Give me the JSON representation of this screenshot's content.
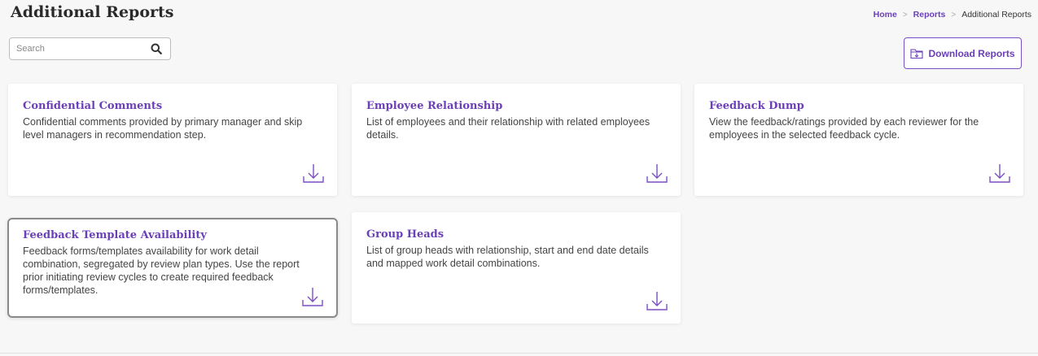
{
  "page": {
    "title": "Additional Reports"
  },
  "breadcrumb": {
    "home": "Home",
    "reports": "Reports",
    "current": "Additional Reports"
  },
  "search": {
    "placeholder": "Search",
    "value": ""
  },
  "toolbar": {
    "download_label": "Download Reports"
  },
  "colors": {
    "accent": "#6b3fb8",
    "selected_border": "#8a8a8a"
  },
  "cards": [
    {
      "title": "Confidential Comments",
      "description": "Confidential comments provided by primary manager and skip level managers in recommendation step."
    },
    {
      "title": "Employee Relationship",
      "description": "List of employees and their relationship with related employees details."
    },
    {
      "title": "Feedback Dump",
      "description": "View the feedback/ratings provided by each reviewer for the employees in the selected feedback cycle."
    },
    {
      "title": "Feedback Template Availability",
      "description": "Feedback forms/templates availability for work detail combination, segregated by review plan types. Use the report prior initiating review cycles to create required feedback forms/templates."
    },
    {
      "title": "Group Heads",
      "description": "List of group heads with relationship, start and end date details and mapped work detail combinations."
    }
  ]
}
